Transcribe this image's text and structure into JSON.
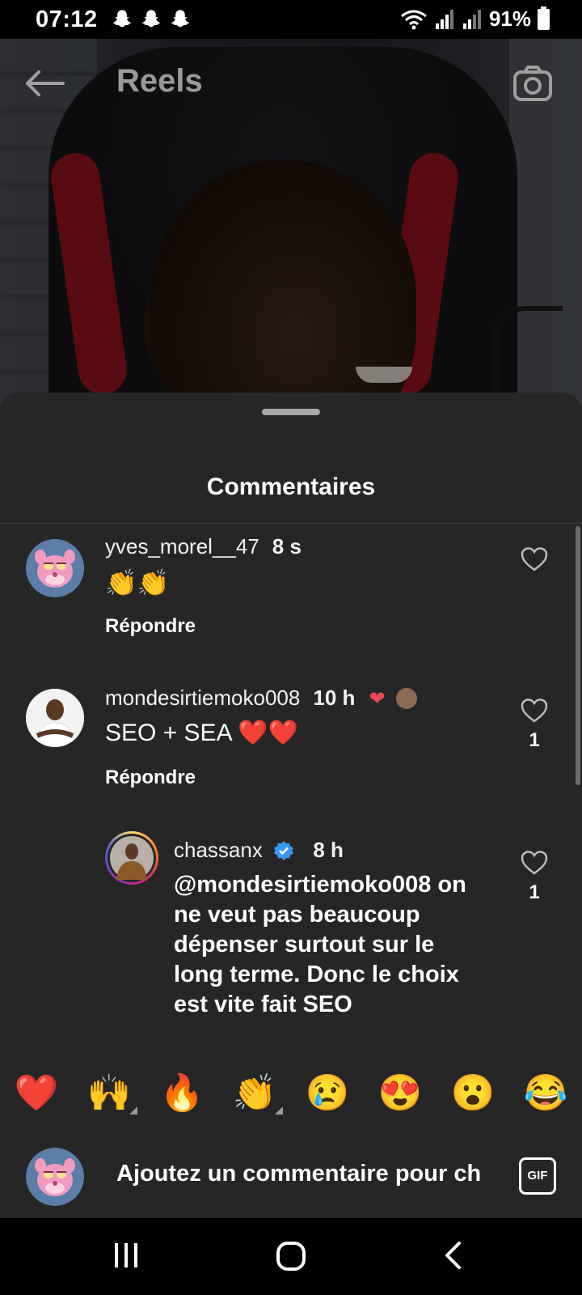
{
  "status_bar": {
    "time": "07:12",
    "battery": "91%",
    "notification_icons": [
      "snapchat-icon",
      "snapchat-icon",
      "snapchat-icon"
    ]
  },
  "header": {
    "title": "Reels"
  },
  "sheet": {
    "title": "Commentaires"
  },
  "comments": [
    {
      "username": "yves_morel__47",
      "time": "8 s",
      "text": "👏👏",
      "reply_label": "Répondre",
      "likes": ""
    },
    {
      "username": "mondesirtiemoko008",
      "time": "10 h",
      "text": "SEO + SEA ❤️❤️",
      "reply_label": "Répondre",
      "likes": "1"
    },
    {
      "username": "chassanx",
      "time": "8 h",
      "verified": true,
      "text": "@mondesirtiemoko008 on ne veut pas beaucoup dépenser surtout sur le long terme. Donc le choix est vite fait SEO",
      "likes": "1"
    }
  ],
  "emoji_bar": [
    "❤️",
    "🙌",
    "🔥",
    "👏",
    "😢",
    "😍",
    "😮",
    "😂"
  ],
  "composer": {
    "placeholder": "Ajoutez un commentaire pour ch",
    "gif_label": "GIF"
  },
  "colors": {
    "sheet_bg": "#262626",
    "verified": "#3897f0",
    "heart_red": "#ed4956"
  }
}
